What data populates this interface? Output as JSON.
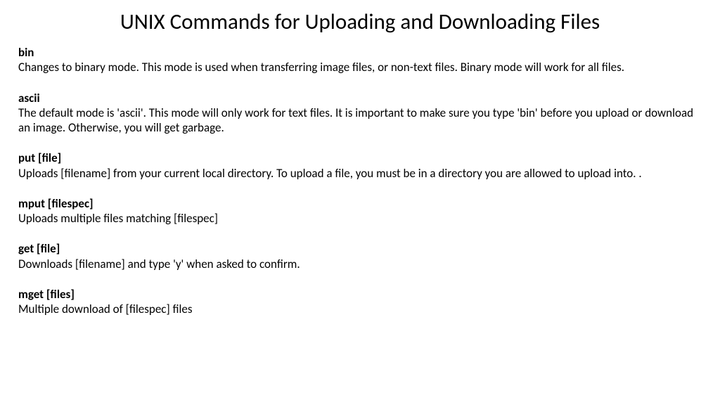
{
  "title": "UNIX Commands for Uploading and Downloading Files",
  "commands": [
    {
      "name": "bin",
      "desc": "Changes to binary mode.  This mode is used when transferring image files, or non-text files. Binary mode will work for all files."
    },
    {
      "name": "ascii",
      "desc": "The default mode is 'ascii'.  This mode will only work for text files. It is important to make sure you type 'bin' before you upload or download an image.  Otherwise, you will get garbage."
    },
    {
      "name": "put [file]",
      "desc": "Uploads [filename] from your current local directory.  To upload a file, you must be in a directory you are allowed to upload into.  ."
    },
    {
      "name": "mput [filespec]",
      "desc": "Uploads multiple files matching [filespec]"
    },
    {
      "name": "get [file]",
      "desc": "Downloads [filename] and type 'y' when asked to confirm."
    },
    {
      "name": "mget [files]",
      "desc": "Multiple download of [filespec] files"
    }
  ]
}
